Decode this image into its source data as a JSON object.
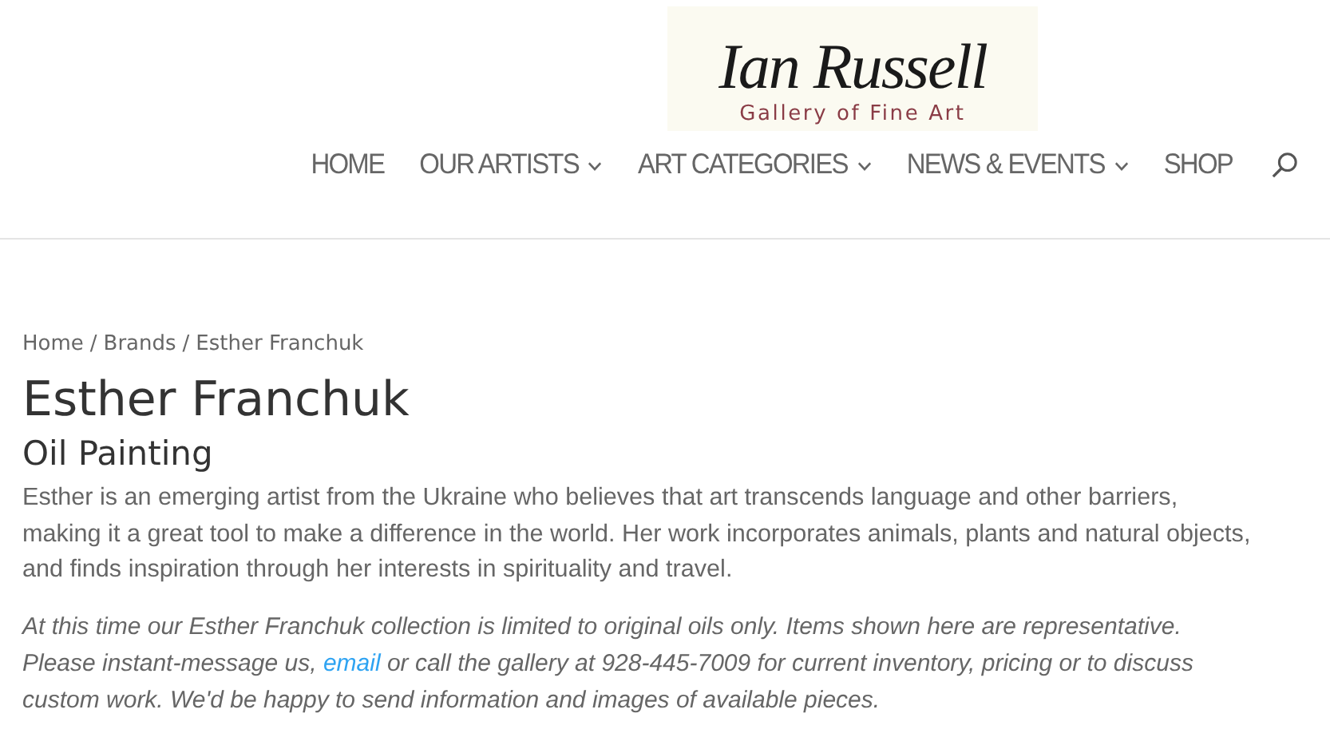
{
  "logo": {
    "signature": "Ian Russell",
    "tagline": "Gallery of Fine Art"
  },
  "nav": [
    {
      "label": "HOME",
      "has_submenu": false
    },
    {
      "label": "OUR ARTISTS",
      "has_submenu": true
    },
    {
      "label": "ART CATEGORIES",
      "has_submenu": true
    },
    {
      "label": "NEWS & EVENTS",
      "has_submenu": true
    },
    {
      "label": "SHOP",
      "has_submenu": false
    }
  ],
  "breadcrumb": [
    "Home",
    "Brands",
    "Esther Franchuk"
  ],
  "breadcrumb_separator": "/",
  "title": "Esther Franchuk",
  "subtitle": "Oil Painting",
  "description": "Esther is an emerging artist from the Ukraine who believes that art transcends language and other barriers, making it a great tool to make a difference in the world. Her work incorporates animals, plants and natural objects, and finds inspiration through her interests in spirituality and travel.",
  "note": {
    "before": "At this time our Esther Franchuk collection is limited to original oils only. Items shown here are representative. Please instant-message us, ",
    "link": "email",
    "after": " or call the gallery at 928-445-7009 for current inventory, pricing or to discuss custom work. We'd be happy to send information and images of available pieces."
  }
}
